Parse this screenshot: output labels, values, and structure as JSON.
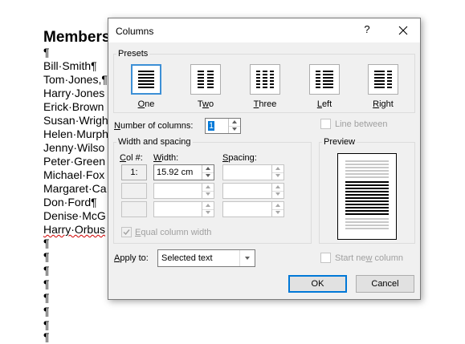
{
  "document": {
    "title": "Members",
    "lines": [
      "¶",
      "Bill·Smith¶",
      "Tom·Jones,¶",
      "Harry·Jones",
      "Erick·Brown",
      "Susan·Wrigh",
      "Helen·Murph",
      "Jenny·Wilso",
      "Peter·Green",
      "Michael·Fox",
      "Margaret·Ca",
      "Don·Ford¶",
      "Denise·McG",
      "Harry·Orbus",
      "¶",
      "¶",
      "¶",
      "¶",
      "¶",
      "¶",
      "¶",
      "¶"
    ]
  },
  "dialog": {
    "title": "Columns",
    "help_label": "?",
    "presets": {
      "label": "Presets",
      "items": [
        {
          "label_u": "O",
          "label_rest": "ne",
          "selected": true
        },
        {
          "label_pre": "T",
          "label_u": "w",
          "label_rest": "o",
          "selected": false
        },
        {
          "label_u": "T",
          "label_rest": "hree",
          "selected": false
        },
        {
          "label_u": "L",
          "label_rest": "eft",
          "selected": false
        },
        {
          "label_u": "R",
          "label_rest": "ight",
          "selected": false
        }
      ]
    },
    "number_of_columns": {
      "label_u": "N",
      "label_rest": "umber of columns:",
      "value": "1"
    },
    "line_between": {
      "label": "Line between",
      "checked": false
    },
    "width_spacing": {
      "label": "Width and spacing",
      "col_header_u": "C",
      "col_header_rest": "ol #:",
      "width_header_u": "W",
      "width_header_rest": "idth:",
      "spacing_header_u": "S",
      "spacing_header_rest": "pacing:",
      "rows": [
        {
          "col": "1:",
          "width": "15.92 cm",
          "spacing": ""
        },
        {
          "col": "",
          "width": "",
          "spacing": ""
        },
        {
          "col": "",
          "width": "",
          "spacing": ""
        }
      ],
      "equal_width": {
        "label_u": "E",
        "label_rest": "qual column width",
        "checked": true
      }
    },
    "preview": {
      "label": "Preview"
    },
    "apply_to": {
      "label_u": "A",
      "label_rest": "pply to:",
      "value": "Selected text"
    },
    "start_new_column": {
      "label_pre": "Start ne",
      "label_u": "w",
      "label_rest": " column",
      "checked": false
    },
    "ok_label": "OK",
    "cancel_label": "Cancel",
    "colors": {
      "accent": "#0078d7",
      "selected_preset": "#3c8fd6",
      "disabled_text": "#a0a0a0"
    }
  }
}
